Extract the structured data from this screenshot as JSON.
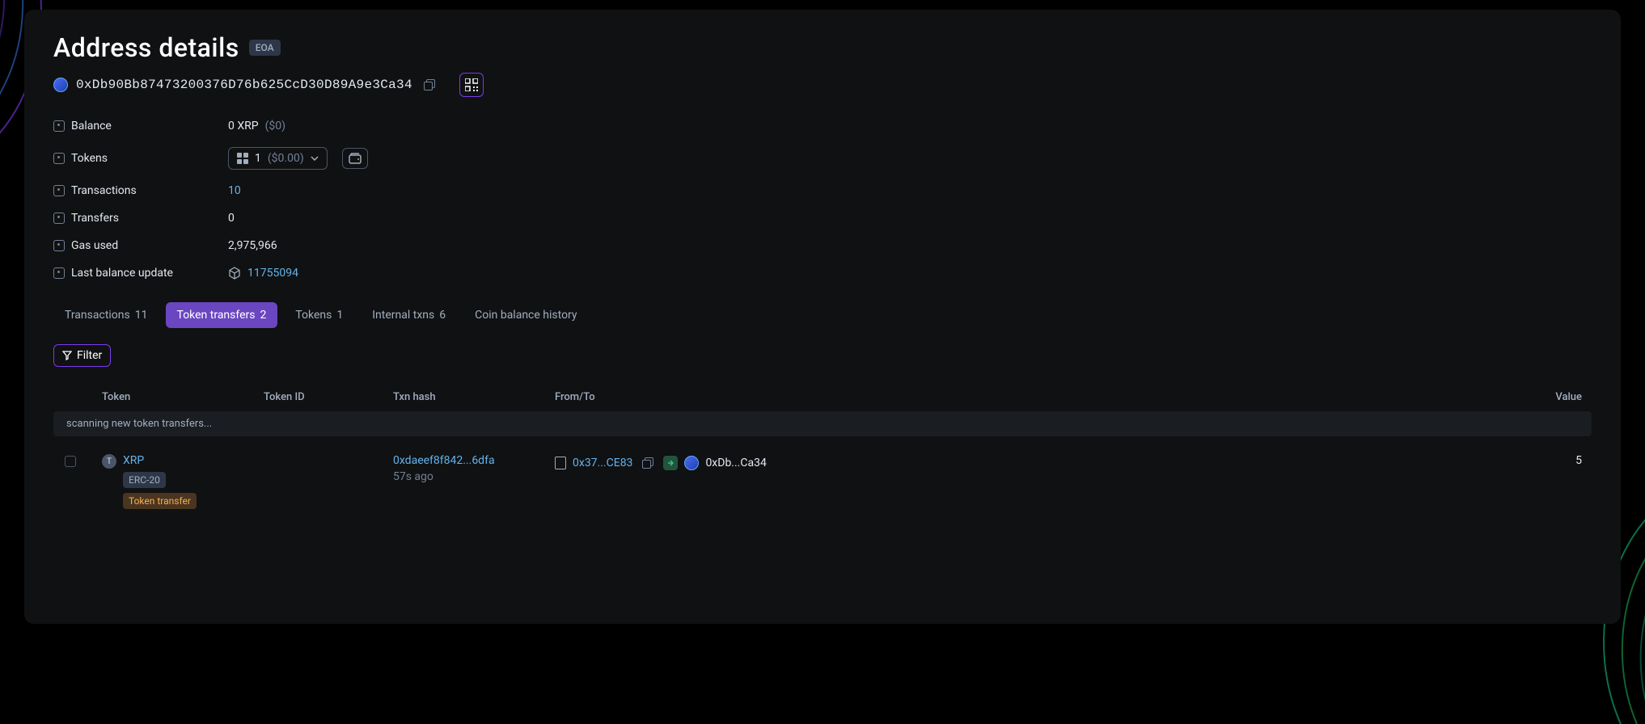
{
  "header": {
    "title": "Address details",
    "badge": "EOA",
    "address": "0xDb90Bb87473200376D76b625CcD30D89A9e3Ca34"
  },
  "info": {
    "balance": {
      "label": "Balance",
      "value": "0 XRP ",
      "fiat": "($0)"
    },
    "tokens": {
      "label": "Tokens",
      "count": "1",
      "fiat": "($0.00)"
    },
    "transactions": {
      "label": "Transactions",
      "value": "10"
    },
    "transfers": {
      "label": "Transfers",
      "value": "0"
    },
    "gas_used": {
      "label": "Gas used",
      "value": "2,975,966"
    },
    "last_update": {
      "label": "Last balance update",
      "value": "11755094"
    }
  },
  "tabs": [
    {
      "label": "Transactions",
      "count": "11"
    },
    {
      "label": "Token transfers",
      "count": "2"
    },
    {
      "label": "Tokens",
      "count": "1"
    },
    {
      "label": "Internal txns",
      "count": "6"
    },
    {
      "label": "Coin balance history",
      "count": ""
    }
  ],
  "filter": {
    "label": "Filter"
  },
  "table": {
    "headers": {
      "token": "Token",
      "token_id": "Token ID",
      "txn_hash": "Txn hash",
      "from_to": "From/To",
      "value": "Value"
    },
    "scanning": "scanning new token transfers...",
    "rows": [
      {
        "token_symbol": "XRP",
        "token_avatar": "T",
        "token_type": "ERC-20",
        "transfer_type": "Token transfer",
        "txn_hash": "0xdaeef8f842...6dfa",
        "txn_time": "57s ago",
        "from": "0x37...CE83",
        "to": "0xDb...Ca34",
        "value": "5"
      }
    ]
  }
}
